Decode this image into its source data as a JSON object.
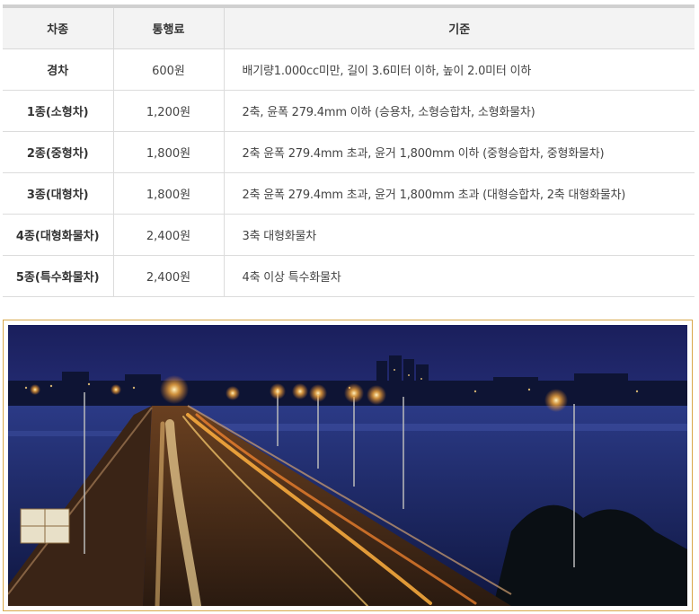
{
  "table": {
    "headers": {
      "type": "차종",
      "fee": "통행료",
      "standard": "기준"
    },
    "rows": [
      {
        "type": "경차",
        "fee": "600원",
        "standard": "배기량1.000cc미만, 길이 3.6미터 이하, 높이 2.0미터 이하"
      },
      {
        "type": "1종(소형차)",
        "fee": "1,200원",
        "standard": "2축, 윤폭 279.4mm 이하 (승용차, 소형승합차, 소형화물차)"
      },
      {
        "type": "2종(중형차)",
        "fee": "1,800원",
        "standard": "2축 윤폭 279.4mm 초과, 윤거 1,800mm 이하 (중형승합차, 중형화물차)"
      },
      {
        "type": "3종(대형차)",
        "fee": "1,800원",
        "standard": "2축 윤폭 279.4mm 초과, 윤거 1,800mm 초과 (대형승합차, 2축 대형화물차)"
      },
      {
        "type": "4종(대형화물차)",
        "fee": "2,400원",
        "standard": "3축 대형화물차"
      },
      {
        "type": "5종(특수화물차)",
        "fee": "2,400원",
        "standard": "4축 이상 특수화물차"
      }
    ]
  },
  "photo": {
    "frame_color": "#d8a84a",
    "sky_top": "#1a1f5c",
    "sky_bottom": "#3c4aa0",
    "light_color": "#ffb040"
  }
}
